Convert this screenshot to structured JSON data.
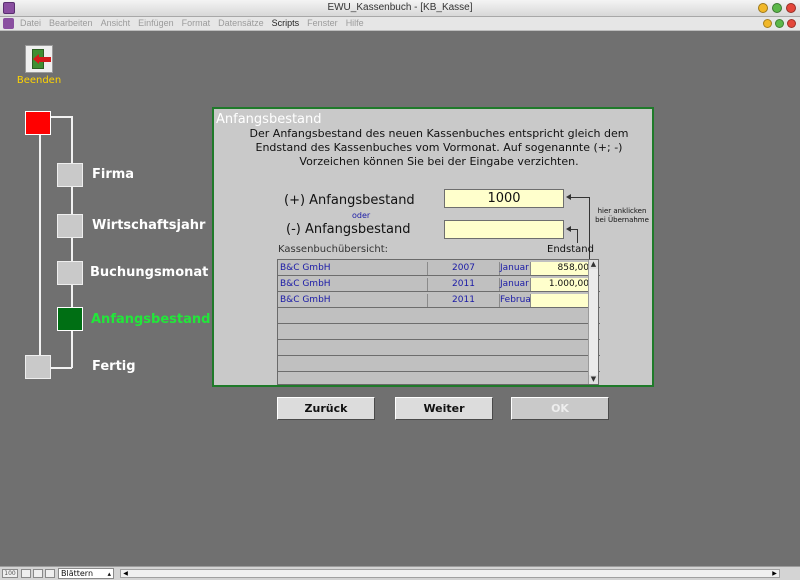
{
  "window": {
    "title": "EWU_Kassenbuch - [KB_Kasse]",
    "controls": {
      "close": "#e4473b",
      "minimize": "#f1b829",
      "zoom": "#5bb749"
    }
  },
  "menu": [
    "Datei",
    "Bearbeiten",
    "Ansicht",
    "Einfügen",
    "Format",
    "Datensätze",
    "Scripts",
    "Fenster",
    "Hilfe"
  ],
  "menu_active_index": 6,
  "beenden": {
    "label": "Beenden",
    "icon": "exit-door-icon"
  },
  "steps": [
    {
      "label": "",
      "state": "start"
    },
    {
      "label": "Firma",
      "state": "open"
    },
    {
      "label": "Wirtschaftsjahr",
      "state": "open"
    },
    {
      "label": "Buchungsmonat",
      "state": "open"
    },
    {
      "label": "Anfangsbestand",
      "state": "current"
    },
    {
      "label": "Fertig",
      "state": "open"
    }
  ],
  "panel": {
    "title": "Anfangsbestand",
    "description": "Der Anfangsbestand des neuen Kassenbuches entspricht gleich dem Endstand des Kassenbuches vom Vormonat. Auf sogenannte (+; -) Vorzeichen können Sie bei der Eingabe verzichten.",
    "plus_label": "(+) Anfangsbestand",
    "plus_value": "1000",
    "oder": "oder",
    "minus_label": "(-) Anfangsbestand",
    "minus_value": "",
    "hint": "hier anklicken bei Übernahme",
    "overview_label": "Kassenbuchübersicht:",
    "endstand_label": "Endstand",
    "rows": [
      {
        "firm": "B&C GmbH",
        "year": "2007",
        "month": "Januar",
        "end": "858,00"
      },
      {
        "firm": "B&C GmbH",
        "year": "2011",
        "month": "Januar",
        "end": "1.000,00"
      },
      {
        "firm": "B&C GmbH",
        "year": "2011",
        "month": "Februar",
        "end": ""
      }
    ]
  },
  "buttons": {
    "back": "Zurück",
    "next": "Weiter",
    "ok": "OK"
  },
  "status": {
    "zoom": "100",
    "mode": "Blättern"
  }
}
